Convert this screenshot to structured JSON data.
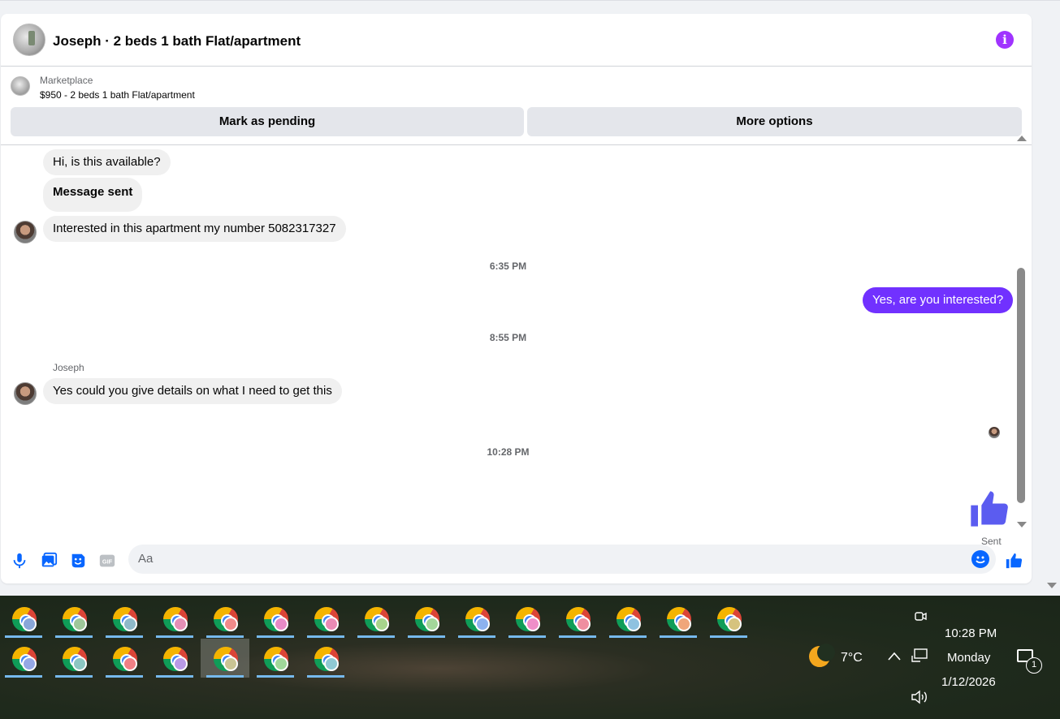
{
  "header": {
    "title": "Joseph · 2 beds 1 bath Flat/apartment"
  },
  "listing": {
    "source": "Marketplace",
    "summary": "$950 - 2 beds 1 bath Flat/apartment",
    "mark_pending_label": "Mark as pending",
    "more_options_label": "More options"
  },
  "messages": {
    "m1": "Hi, is this available?",
    "m2": "Message sent",
    "m3": "Interested in this apartment my number 5082317327",
    "ts1": "6:35 PM",
    "m4": "Yes, are you interested?",
    "ts2": "8:55 PM",
    "sender": "Joseph",
    "m5": "Yes could you give details on what I need to get this",
    "ts3": "10:28 PM",
    "sent_status": "Sent"
  },
  "composer": {
    "placeholder": "Aa",
    "gif_label": "GIF"
  },
  "colors": {
    "accent": "#7131ff",
    "info": "#a033ff",
    "messenger_blue": "#0866ff",
    "like": "#5b5cf0"
  },
  "taskbar": {
    "weather_temp": "7°C",
    "time": "10:28 PM",
    "day": "Monday",
    "date": "1/12/2026",
    "notification_count": "1"
  }
}
